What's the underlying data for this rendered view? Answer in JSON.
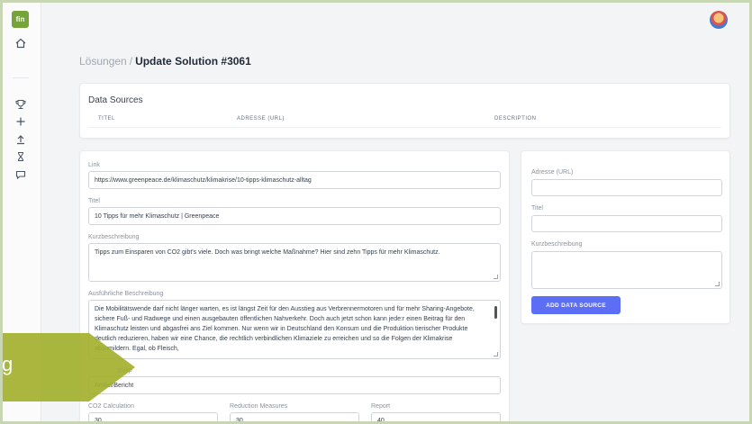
{
  "app": {
    "logo_text": "fin"
  },
  "sidebar": {
    "icons": [
      "home-icon",
      "trophy-icon",
      "plus-icon",
      "upload-icon",
      "hourglass-icon",
      "chat-icon"
    ]
  },
  "breadcrumb": {
    "parent": "Lösungen",
    "separator": "/",
    "current": "Update Solution #3061"
  },
  "data_sources": {
    "title": "Data Sources",
    "columns": [
      "TITEL",
      "ADRESSE (URL)",
      "DESCRIPTION"
    ]
  },
  "form": {
    "link_label": "Link",
    "link_value": "https://www.greenpeace.de/klimaschutz/klimakrise/10-tipps-klimaschutz-alltag",
    "title_label": "Titel",
    "title_value": "10 Tipps für mehr Klimaschutz | Greenpeace",
    "short_label": "Kurzbeschreibung",
    "short_value": "Tipps zum Einsparen von CO2 gibt's viele. Doch was bringt welche Maßnahme? Hier sind zehn Tipps für mehr Klimaschutz.",
    "long_label": "Ausführliche Beschreibung",
    "long_value": "Die Mobilitätswende darf nicht länger warten, es ist längst Zeit für den Ausstieg aus Verbrennermotoren und für mehr Sharing-Angebote, sichere Fuß- und Radwege und einen ausgebauten öffentlichen Nahverkehr. Doch auch jetzt schon kann jede:r einen Beitrag für den Klimaschutz leisten und abgasfrei ans Ziel kommen. Nur wenn wir in Deutschland den Konsum und die Produktion tierischer Produkte deutlich reduzieren, haben wir eine Chance, die rechtlich verbindlichen Klimaziele zu erreichen und so die Folgen der Klimakrise abzumildern. Egal, ob Fleisch,",
    "type_label": "gstyp",
    "type_value": "Artikel/Bericht",
    "co2_label": "CO2 Calculation",
    "co2_value": "30",
    "reduction_label": "Reduction Measures",
    "reduction_value": "30",
    "report_label": "Report",
    "report_value": "40"
  },
  "side_form": {
    "url_label": "Adresse (URL)",
    "title_label": "Titel",
    "desc_label": "Kurzbeschreibung",
    "button_label": "ADD DATA SOURCE"
  },
  "overlay": {
    "text": "g",
    "color": "#a3b02e"
  },
  "colors": {
    "accent": "#5b6ef5",
    "brand": "#76a33a"
  }
}
